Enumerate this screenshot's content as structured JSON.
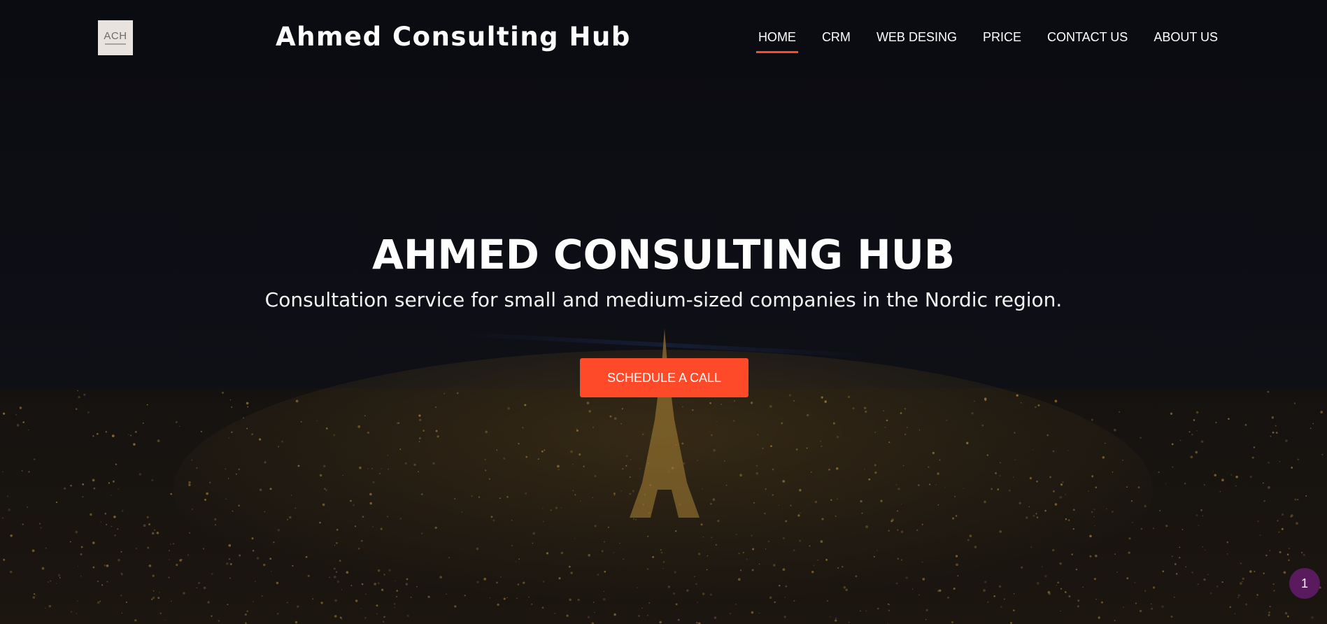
{
  "header": {
    "logo_text": "ACH",
    "site_title": "Ahmed Consulting Hub",
    "nav": [
      {
        "label": "HOME",
        "active": true
      },
      {
        "label": "CRM",
        "active": false
      },
      {
        "label": "WEB DESING",
        "active": false
      },
      {
        "label": "PRICE",
        "active": false
      },
      {
        "label": "CONTACT US",
        "active": false
      },
      {
        "label": "ABOUT US",
        "active": false
      }
    ]
  },
  "hero": {
    "title": "AHMED CONSULTING HUB",
    "subtitle": "Consultation service for small and medium-sized companies in the Nordic region.",
    "cta_label": "SCHEDULE A CALL"
  },
  "badge": {
    "count": "1"
  },
  "colors": {
    "accent": "#ff4a2a",
    "badge": "#5a1a5e",
    "background": "#0c0e13"
  }
}
